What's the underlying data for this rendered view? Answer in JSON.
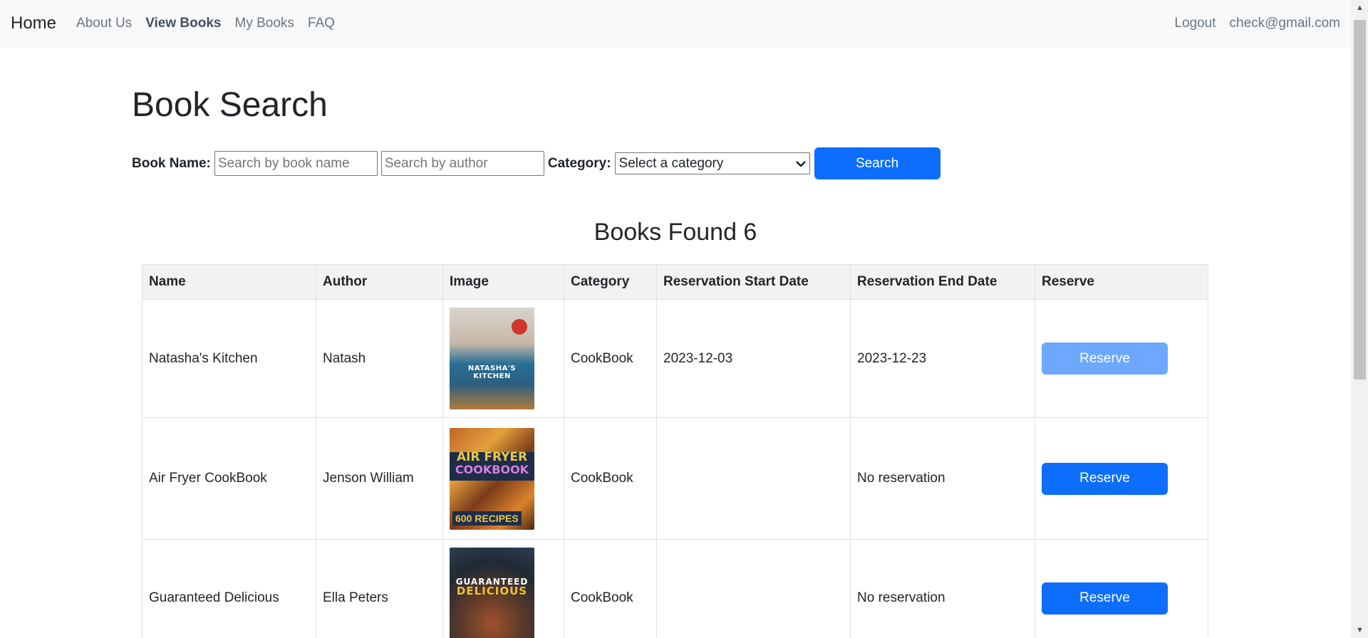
{
  "navbar": {
    "brand": "Home",
    "links": [
      {
        "label": "About Us"
      },
      {
        "label": "View Books"
      },
      {
        "label": "My Books"
      },
      {
        "label": "FAQ"
      }
    ],
    "right": {
      "logout": "Logout",
      "user_email": "check@gmail.com"
    }
  },
  "main": {
    "title": "Book Search",
    "search": {
      "book_name_label": "Book Name:",
      "book_name_placeholder": "Search by book name",
      "author_placeholder": "Search by author",
      "category_label": "Category:",
      "category_selected": "Select a category",
      "search_button": "Search"
    },
    "results_heading": "Books Found 6",
    "table": {
      "headers": [
        "Name",
        "Author",
        "Image",
        "Category",
        "Reservation Start Date",
        "Reservation End Date",
        "Reserve"
      ],
      "rows": [
        {
          "name": "Natasha's Kitchen",
          "author": "Natash",
          "cover_text": "NATASHA'S KITCHEN",
          "category": "CookBook",
          "start_date": "2023-12-03",
          "end_date": "2023-12-23",
          "reserve_label": "Reserve",
          "reserve_disabled": true
        },
        {
          "name": "Air Fryer CookBook",
          "author": "Jenson William",
          "cover_text": "AIR FRYER",
          "cover_sub": "COOKBOOK",
          "cover_num": "600 RECIPES",
          "category": "CookBook",
          "start_date": "",
          "end_date": "No reservation",
          "reserve_label": "Reserve",
          "reserve_disabled": false
        },
        {
          "name": "Guaranteed Delicious",
          "author": "Ella Peters",
          "cover_text": "GUARANTEED",
          "cover_sub": "DELICIOUS",
          "category": "CookBook",
          "start_date": "",
          "end_date": "No reservation",
          "reserve_label": "Reserve",
          "reserve_disabled": false
        }
      ]
    }
  },
  "colors": {
    "primary": "#0d6efd",
    "primary_disabled": "#6ea8fe",
    "navbar_bg": "#f8f9fa",
    "table_header_bg": "#f2f2f2"
  }
}
